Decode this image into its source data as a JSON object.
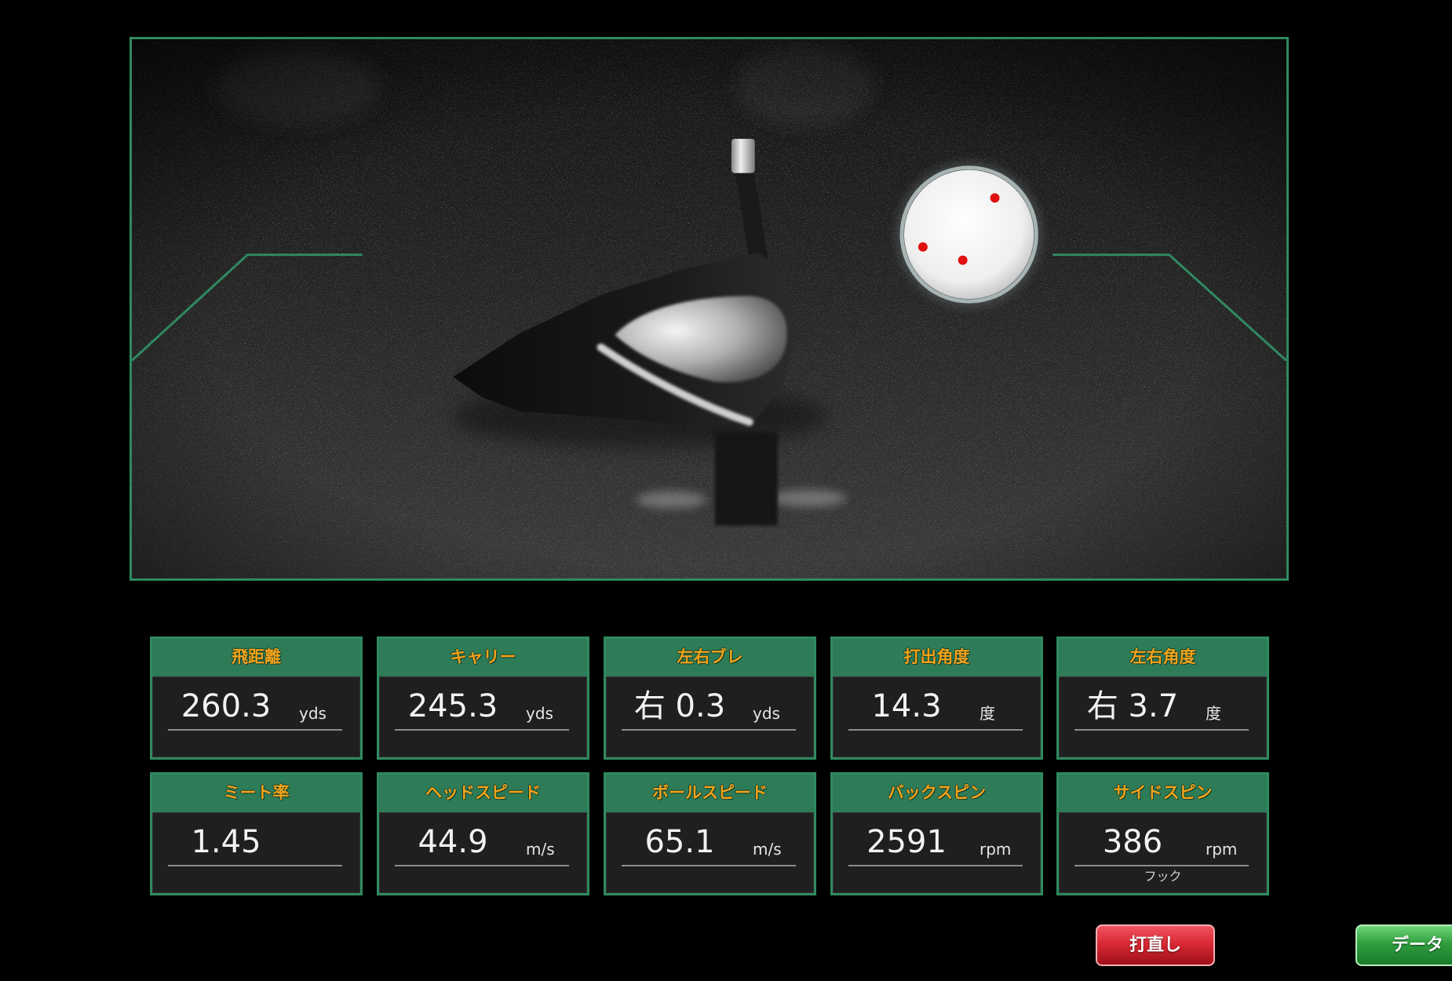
{
  "colors": {
    "background": "#000000",
    "frame_green": "#2f8a5f",
    "card_header": "#2e7b57",
    "label_orange": "#f2a31c",
    "value_text": "#f2f2f2",
    "retry_button": "#d92a34",
    "data_button": "#2f9e3e",
    "ball_marker": "#e01010"
  },
  "metrics": {
    "row1": [
      {
        "label": "飛距離",
        "value": "260.3",
        "unit": "yds"
      },
      {
        "label": "キャリー",
        "value": "245.3",
        "unit": "yds"
      },
      {
        "label": "左右ブレ",
        "value": "右 0.3",
        "unit": "yds"
      },
      {
        "label": "打出角度",
        "value": "14.3",
        "unit": "度"
      },
      {
        "label": "左右角度",
        "value": "右 3.7",
        "unit": "度"
      }
    ],
    "row2": [
      {
        "label": "ミート率",
        "value": "1.45"
      },
      {
        "label": "ヘッドスピード",
        "value": "44.9",
        "unit": "m/s"
      },
      {
        "label": "ボールスピード",
        "value": "65.1",
        "unit": "m/s"
      },
      {
        "label": "バックスピン",
        "value": "2591",
        "unit": "rpm"
      },
      {
        "label": "サイドスピン",
        "value": "386",
        "unit": "rpm",
        "sublabel": "フック"
      }
    ]
  },
  "buttons": {
    "retry": "打直し",
    "data": "データ"
  }
}
